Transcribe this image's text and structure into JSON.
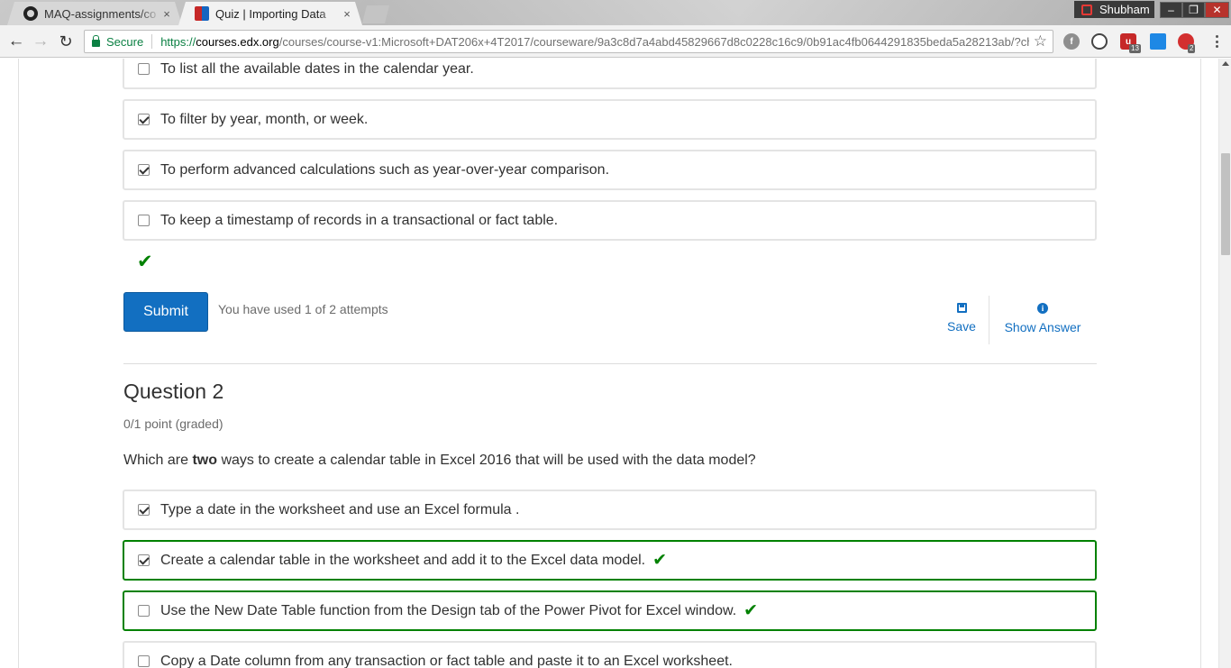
{
  "browser": {
    "tabs": [
      {
        "title": "MAQ-assignments/co",
        "favicon": "github-icon",
        "close": "×"
      },
      {
        "title": "Quiz | Importing Data",
        "favicon": "edx-icon",
        "close": "×"
      }
    ],
    "profile_name": "Shubham",
    "window_controls": {
      "minimize": "–",
      "maximize": "❐",
      "close": "✕"
    },
    "secure_label": "Secure",
    "url": {
      "scheme": "https://",
      "host": "courses.edx.org",
      "path": "/courses/course-v1:Microsoft+DAT206x+4T2017/courseware/9a3c8d7a4abd45829667d8c0228c16c9/0b91ac4fb0644291835beda5a28213ab/?chil..."
    },
    "nav_icons": {
      "back": "←",
      "forward": "→",
      "reload": "↻",
      "star": "☆"
    },
    "extensions": [
      {
        "name": "ext-reddit-icon",
        "badge": ""
      },
      {
        "name": "ext-speed-icon",
        "badge": ""
      },
      {
        "name": "ext-ublock-icon",
        "badge": "13"
      },
      {
        "name": "ext-photo-icon",
        "badge": ""
      },
      {
        "name": "ext-adblock-icon",
        "badge": "2"
      }
    ]
  },
  "question1": {
    "choices": [
      {
        "text": "To list all the available dates in the calendar year.",
        "checked": false
      },
      {
        "text": "To filter by year, month, or week.",
        "checked": true
      },
      {
        "text": "To perform advanced calculations such as year-over-year comparison.",
        "checked": true
      },
      {
        "text": "To keep a timestamp of records in a transactional or fact table.",
        "checked": false
      }
    ],
    "status_icon": "✔",
    "submit_label": "Submit",
    "attempts_text": "You have used 1 of 2 attempts",
    "save_label": "Save",
    "show_answer_label": "Show Answer"
  },
  "question2": {
    "title": "Question 2",
    "points": "0/1 point (graded)",
    "prompt_before": "Which are ",
    "prompt_bold": "two",
    "prompt_after": " ways to create a calendar table in Excel 2016 that will be used with the data model?",
    "choices": [
      {
        "text": "Type a date in the worksheet and use an Excel formula .",
        "checked": true,
        "correct": false
      },
      {
        "text": "Create a calendar table in the worksheet and add it to the Excel data model.",
        "checked": true,
        "correct": true
      },
      {
        "text": "Use the New Date Table function from the Design tab of the Power Pivot for Excel window.",
        "checked": false,
        "correct": true
      },
      {
        "text": "Copy a Date column from any transaction or fact table and paste it to an Excel worksheet.",
        "checked": false,
        "correct": false
      }
    ],
    "correct_icon": "✔"
  },
  "colors": {
    "accent": "#126fc1",
    "correct": "#008100",
    "text": "#313131",
    "muted": "#6b6b6b"
  }
}
